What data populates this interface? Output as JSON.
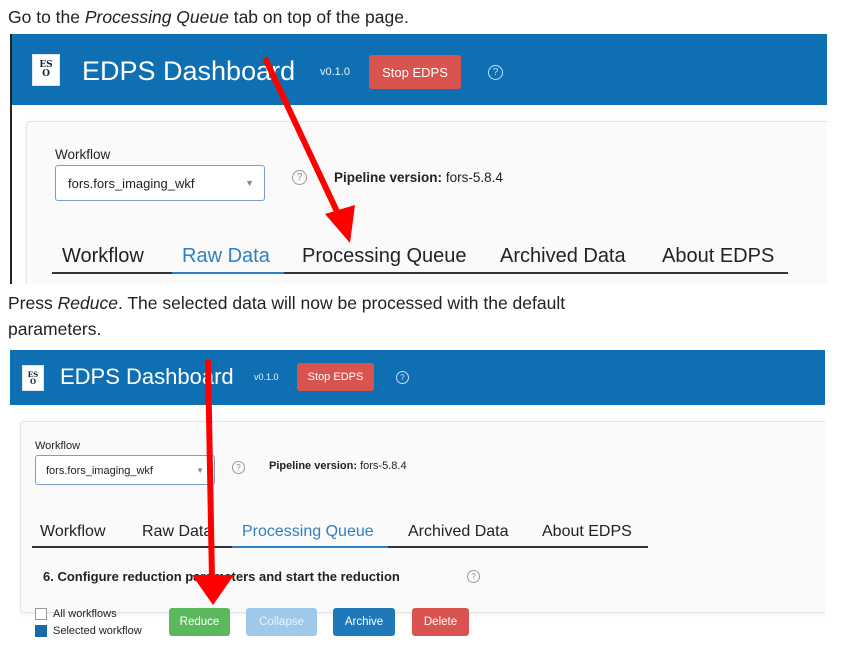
{
  "instructions": {
    "step1_prefix": "Go to the ",
    "step1_em": "Processing Queue",
    "step1_suffix": " tab on top of the page.",
    "step2_prefix": "Press ",
    "step2_em": "Reduce",
    "step2_line1_suffix": ". The selected data will now be processed with the default",
    "step2_line2": "parameters."
  },
  "app": {
    "title": "EDPS Dashboard",
    "version": "v0.1.0",
    "stop_label": "Stop EDPS",
    "help_glyph": "?",
    "logo_text": "ES\nO"
  },
  "workflow": {
    "label": "Workflow",
    "selected": "fors.fors_imaging_wkf",
    "caret": "▼"
  },
  "pipeline": {
    "label": "Pipeline version:",
    "value": "fors-5.8.4"
  },
  "tabs": [
    "Workflow",
    "Raw Data",
    "Processing Queue",
    "Archived Data",
    "About EDPS"
  ],
  "processing": {
    "section_title": "6. Configure reduction parameters and start the reduction",
    "help_glyph": "?",
    "checkbox_all": "All workflows",
    "checkbox_selected": "Selected workflow",
    "buttons": {
      "reduce": "Reduce",
      "collapse": "Collapse",
      "archive": "Archive",
      "delete": "Delete"
    }
  },
  "colors": {
    "topbar": "#0f6fb3",
    "stop": "#d9534f",
    "tab_active": "#2f7fc1",
    "reduce": "#5cb85c",
    "collapse": "#9fc9ea",
    "archive": "#1f78b8",
    "delete": "#d9534f",
    "annotation_arrow": "#ff0000"
  }
}
